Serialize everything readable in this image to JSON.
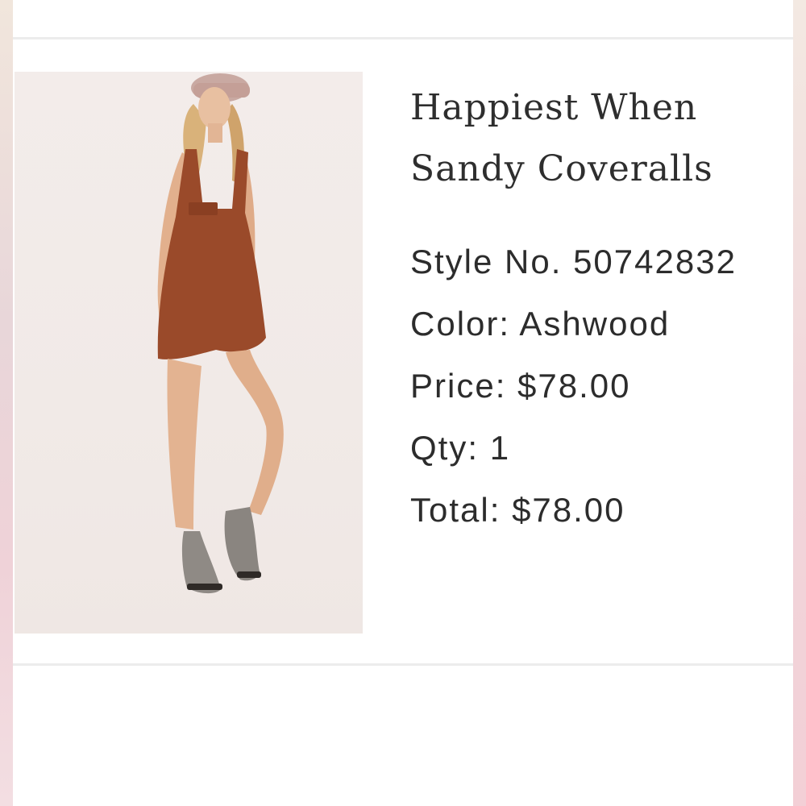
{
  "product": {
    "image_alt": "model wearing rust coveralls",
    "title_line1": "Happiest When",
    "title_line2": "Sandy Coveralls",
    "style_label": "Style No.",
    "style_no": "50742832",
    "color_label": "Color:",
    "color": "Ashwood",
    "price_label": "Price:",
    "price": "$78.00",
    "qty_label": "Qty:",
    "qty": "1",
    "total_label": "Total:",
    "total": "$78.00"
  },
  "colors": {
    "coverall": "#9a4a2a",
    "text": "#2c2c2c",
    "divider": "#ececec"
  }
}
